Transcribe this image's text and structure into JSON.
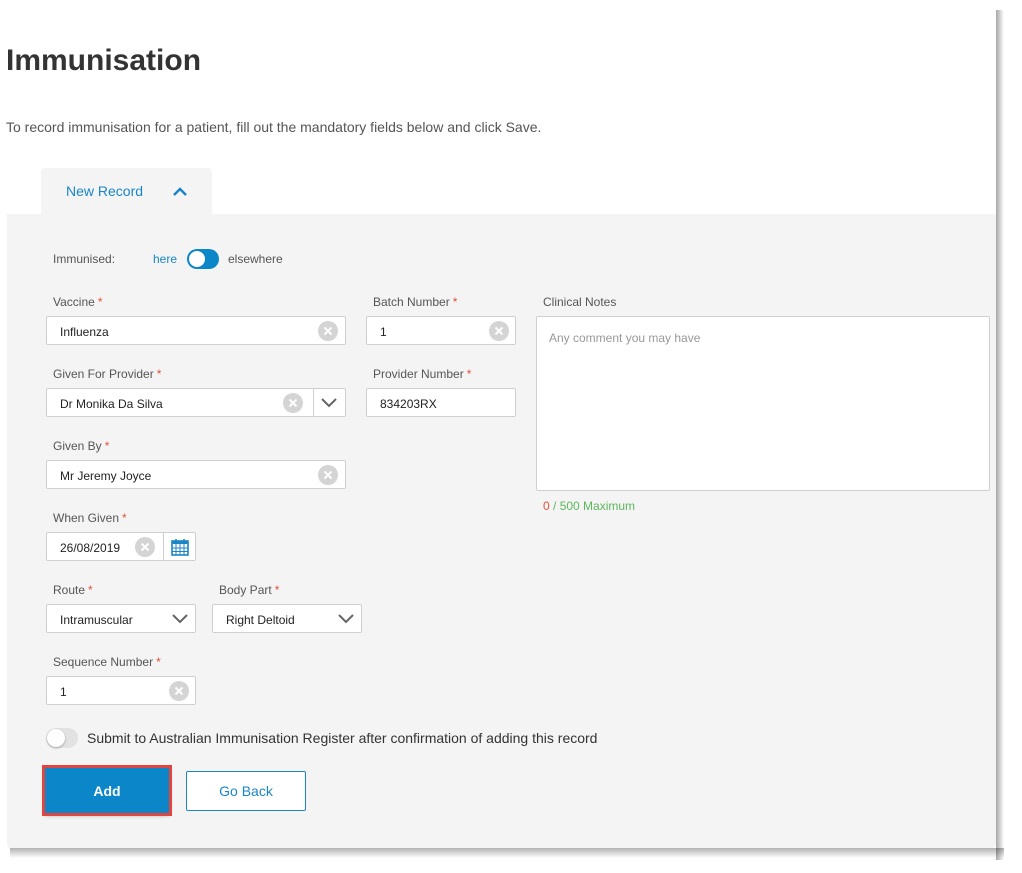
{
  "page": {
    "title": "Immunisation",
    "subtitle": "To record immunisation for a patient, fill out the mandatory fields below and click Save."
  },
  "tab": {
    "label": "New Record",
    "expanded": true
  },
  "immunised": {
    "label": "Immunised:",
    "option_here": "here",
    "option_elsewhere": "elsewhere"
  },
  "fields": {
    "vaccine": {
      "label": "Vaccine",
      "value": "Influenza"
    },
    "batch_number": {
      "label": "Batch Number",
      "value": "1"
    },
    "given_for_provider": {
      "label": "Given For Provider",
      "value": "Dr Monika Da Silva"
    },
    "provider_number": {
      "label": "Provider Number",
      "value": "834203RX"
    },
    "given_by": {
      "label": "Given By",
      "value": "Mr Jeremy Joyce"
    },
    "when_given": {
      "label": "When Given",
      "value": "26/08/2019"
    },
    "route": {
      "label": "Route",
      "value": "Intramuscular"
    },
    "body_part": {
      "label": "Body Part",
      "value": "Right Deltoid"
    },
    "sequence_number": {
      "label": "Sequence Number",
      "value": "1"
    },
    "required_mark": "*"
  },
  "clinical_notes": {
    "label": "Clinical Notes",
    "placeholder": "Any comment you may have",
    "count": "0",
    "max_text": "/ 500 Maximum"
  },
  "air_submit": {
    "label": "Submit to Australian Immunisation Register after confirmation of adding this record"
  },
  "buttons": {
    "add": "Add",
    "go_back": "Go Back"
  },
  "colors": {
    "accent": "#0b86c9",
    "required": "#e0533c",
    "counter_ok": "#5cb85c",
    "highlight": "#e0463f"
  }
}
